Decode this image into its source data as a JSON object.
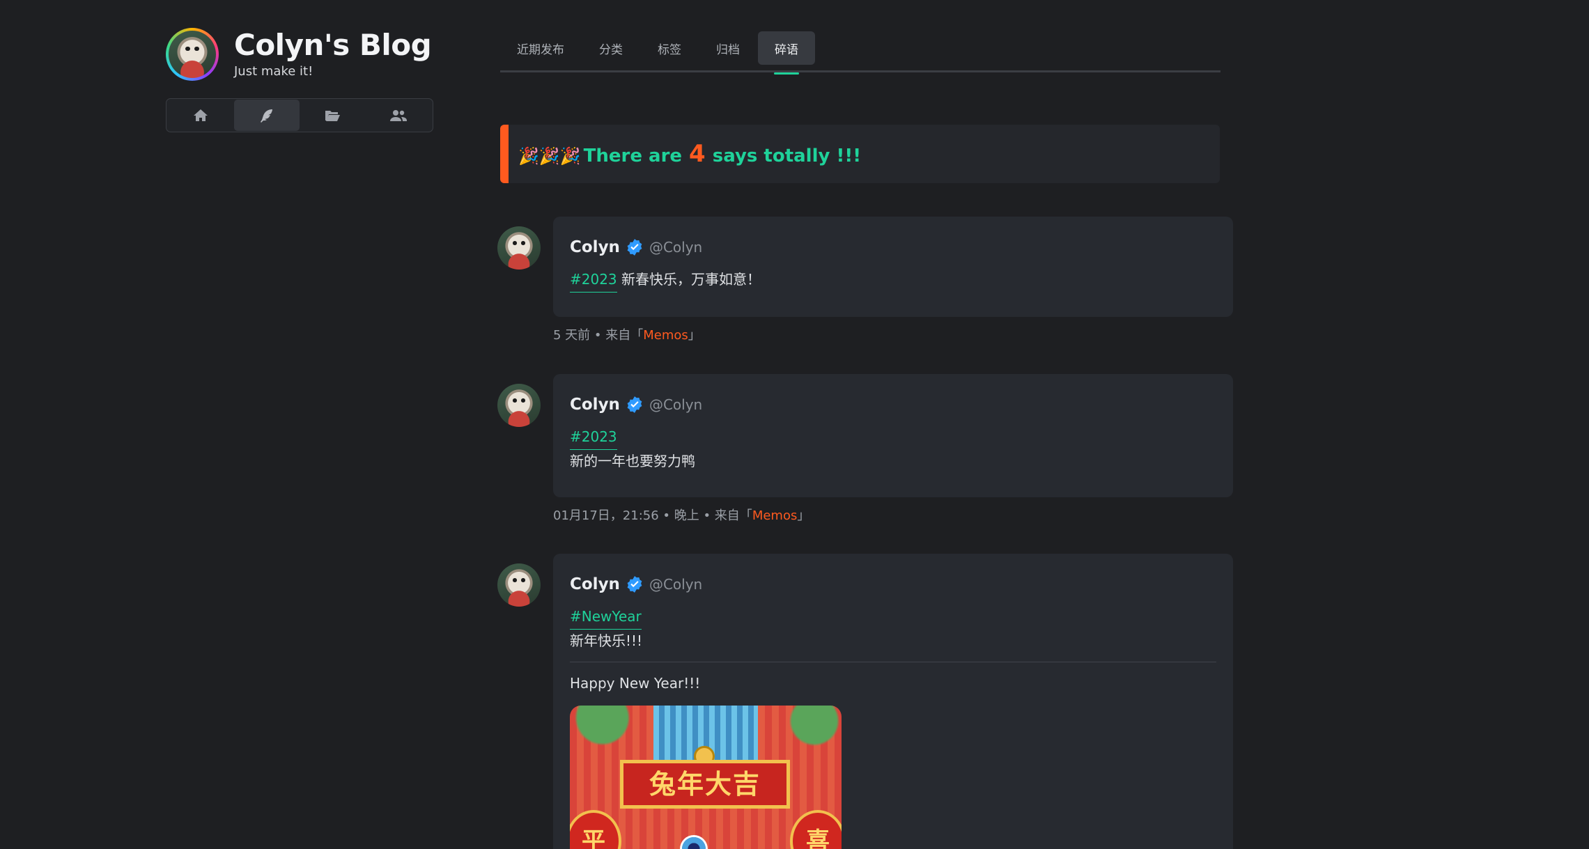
{
  "site": {
    "title": "Colyn's Blog",
    "subtitle": "Just make it!"
  },
  "side_nav": {
    "items": [
      {
        "name": "home",
        "icon": "home-icon"
      },
      {
        "name": "says",
        "icon": "feather-icon",
        "active": true
      },
      {
        "name": "folder",
        "icon": "folder-open-icon"
      },
      {
        "name": "friends",
        "icon": "users-icon"
      }
    ]
  },
  "tabs": {
    "items": [
      "近期发布",
      "分类",
      "标签",
      "归档",
      "碎语"
    ],
    "active": "碎语"
  },
  "banner": {
    "emoji": "🎉🎉🎉",
    "prefix": "There are",
    "count": "4",
    "suffix": "says totally !!!"
  },
  "memos": [
    {
      "author": "Colyn",
      "handle": "@Colyn",
      "tag": "#2023",
      "text": "新春快乐，万事如意！",
      "meta_time": "5 天前 • 来自「",
      "meta_source": "Memos",
      "meta_end": "」"
    },
    {
      "author": "Colyn",
      "handle": "@Colyn",
      "tag": "#2023",
      "text": "新的一年也要努力鸭",
      "meta_time": "01月17日，21:56 • 晚上 • 来自「",
      "meta_source": "Memos",
      "meta_end": "」"
    },
    {
      "author": "Colyn",
      "handle": "@Colyn",
      "tag": "#NewYear",
      "text": "新年快乐!!!",
      "text2": "Happy New Year!!!",
      "image": {
        "sign_text": "兔年大吉",
        "lantern_left": "平",
        "lantern_right": "喜"
      }
    }
  ],
  "colors": {
    "accent_green": "#1fd29a",
    "accent_orange": "#ff5a1f",
    "verified_blue": "#2f9bff"
  }
}
